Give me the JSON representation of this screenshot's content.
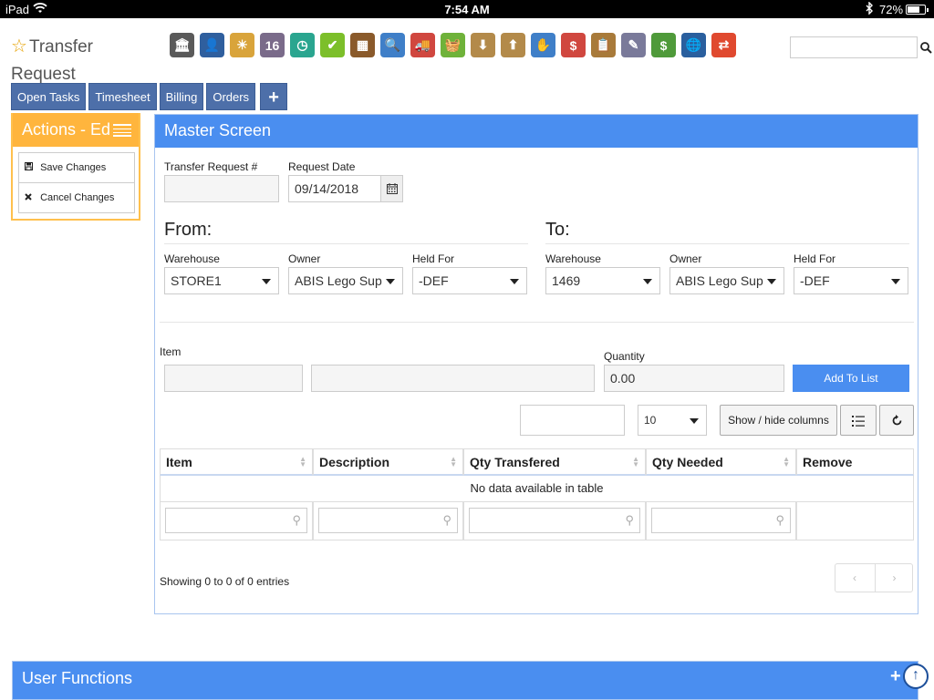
{
  "status_bar": {
    "device": "iPad",
    "time": "7:54 AM",
    "battery": "72%",
    "battery_level": 0.72
  },
  "page_title": {
    "line1": "Transfer",
    "line2": "Request"
  },
  "app_icons": [
    {
      "name": "bank-icon",
      "color": "#5a5a5a",
      "glyph": "🏛"
    },
    {
      "name": "person-icon",
      "color": "#2f5f9e",
      "glyph": "👤"
    },
    {
      "name": "weather-icon",
      "color": "#d9a43b",
      "glyph": "☀"
    },
    {
      "name": "calendar-icon",
      "color": "#7a6b8a",
      "glyph": "16"
    },
    {
      "name": "clock-icon",
      "color": "#2aa58f",
      "glyph": "◷"
    },
    {
      "name": "checkmark-icon",
      "color": "#7cbf2a",
      "glyph": "✔"
    },
    {
      "name": "abacus-icon",
      "color": "#8a5a2b",
      "glyph": "▦"
    },
    {
      "name": "magnifier-icon",
      "color": "#3f7fc8",
      "glyph": "🔍"
    },
    {
      "name": "truck-icon",
      "color": "#d0473f",
      "glyph": "🚚"
    },
    {
      "name": "basket-icon",
      "color": "#6fb23a",
      "glyph": "🧺"
    },
    {
      "name": "box-download-icon",
      "color": "#b38a4a",
      "glyph": "⬇"
    },
    {
      "name": "box-upload-icon",
      "color": "#b38a4a",
      "glyph": "⬆"
    },
    {
      "name": "hand-sign-icon",
      "color": "#3f7fc8",
      "glyph": "✋"
    },
    {
      "name": "price-bubble-icon",
      "color": "#d0473f",
      "glyph": "$"
    },
    {
      "name": "clipboard-icon",
      "color": "#a87a3a",
      "glyph": "📋"
    },
    {
      "name": "document-pen-icon",
      "color": "#7a7a9a",
      "glyph": "✎"
    },
    {
      "name": "cash-icon",
      "color": "#4f9a3a",
      "glyph": "$"
    },
    {
      "name": "book-globe-icon",
      "color": "#2a5f9e",
      "glyph": "🌐"
    },
    {
      "name": "exchange-icon",
      "color": "#e0492f",
      "glyph": "⇄"
    }
  ],
  "nav": {
    "open_tasks": "Open Tasks",
    "timesheet": "Timesheet",
    "billing": "Billing",
    "orders": "Orders",
    "plus": "+"
  },
  "actions": {
    "title": "Actions - Ed",
    "items": [
      {
        "label": "Save Changes",
        "icon": "💾"
      },
      {
        "label": "Cancel Changes",
        "icon": "✖"
      }
    ]
  },
  "master": {
    "title": "Master Screen",
    "transfer_request_label": "Transfer Request #",
    "transfer_request_value": "",
    "request_date_label": "Request Date",
    "request_date_value": "09/14/2018",
    "from": {
      "title": "From:",
      "warehouse_label": "Warehouse",
      "warehouse_value": "STORE1",
      "owner_label": "Owner",
      "owner_value": "ABIS Lego Sup",
      "held_for_label": "Held For",
      "held_for_value": "-DEF"
    },
    "to": {
      "title": "To:",
      "warehouse_label": "Warehouse",
      "warehouse_value": "1469",
      "owner_label": "Owner",
      "owner_value": "ABIS Lego Sup",
      "held_for_label": "Held For",
      "held_for_value": "-DEF"
    },
    "item_label": "Item",
    "quantity_label": "Quantity",
    "quantity_value": "0.00",
    "add_to_list": "Add To List",
    "page_length": "10",
    "show_hide_columns": "Show / hide columns",
    "table": {
      "columns": [
        "Item",
        "Description",
        "Qty Transfered",
        "Qty Needed",
        "Remove"
      ],
      "empty_message": "No data available in table"
    },
    "showing": "Showing 0 to 0 of 0 entries",
    "prev": "‹",
    "next": "›"
  },
  "user_functions": {
    "title": "User Functions",
    "plus": "+"
  }
}
